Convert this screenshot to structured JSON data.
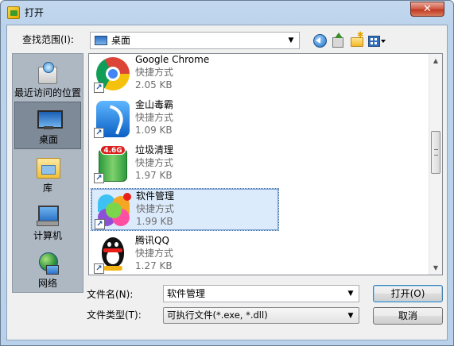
{
  "window": {
    "title": "打开",
    "close_glyph": "✕"
  },
  "toolbar": {
    "lookin_label": "查找范围(I):",
    "lookin_value": "桌面"
  },
  "places": [
    {
      "label": "最近访问的位置",
      "icon": "recent-places-icon"
    },
    {
      "label": "桌面",
      "icon": "desktop-icon",
      "selected": true
    },
    {
      "label": "库",
      "icon": "library-icon"
    },
    {
      "label": "计算机",
      "icon": "computer-icon"
    },
    {
      "label": "网络",
      "icon": "network-icon"
    }
  ],
  "files": [
    {
      "name": "Google Chrome",
      "type": "快捷方式",
      "size": "2.05 KB",
      "icon": "chrome-icon"
    },
    {
      "name": "金山毒霸",
      "type": "快捷方式",
      "size": "1.09 KB",
      "icon": "jinshan-antivirus-icon"
    },
    {
      "name": "垃圾清理",
      "type": "快捷方式",
      "size": "1.97 KB",
      "icon": "recycle-bin-icon",
      "badge": "4.6G"
    },
    {
      "name": "软件管理",
      "type": "快捷方式",
      "size": "1.99 KB",
      "icon": "software-manager-icon",
      "selected": true
    },
    {
      "name": "腾讯QQ",
      "type": "快捷方式",
      "size": "1.27 KB",
      "icon": "qq-penguin-icon"
    }
  ],
  "scrollbar": {
    "position_fraction": 0.42
  },
  "filename": {
    "label": "文件名(N):",
    "value": "软件管理"
  },
  "filetype": {
    "label": "文件类型(T):",
    "value": "可执行文件(*.exe, *.dll)"
  },
  "buttons": {
    "open": "打开(O)",
    "cancel": "取消"
  }
}
